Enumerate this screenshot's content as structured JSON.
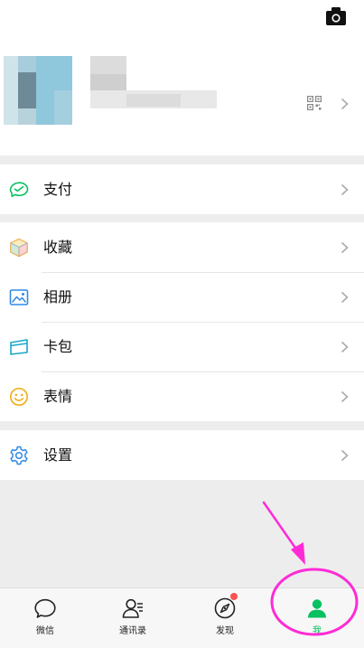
{
  "menu": {
    "pay": "支付",
    "favorites": "收藏",
    "album": "相册",
    "cards": "卡包",
    "stickers": "表情",
    "settings": "设置"
  },
  "tabs": [
    {
      "label": "微信",
      "icon": "chat-icon"
    },
    {
      "label": "通讯录",
      "icon": "contacts-icon"
    },
    {
      "label": "发现",
      "icon": "compass-icon"
    },
    {
      "label": "我",
      "icon": "person-icon"
    }
  ],
  "colors": {
    "accent_green": "#07c160",
    "badge_red": "#fa5151",
    "annotation_magenta": "#ff2bd6"
  }
}
